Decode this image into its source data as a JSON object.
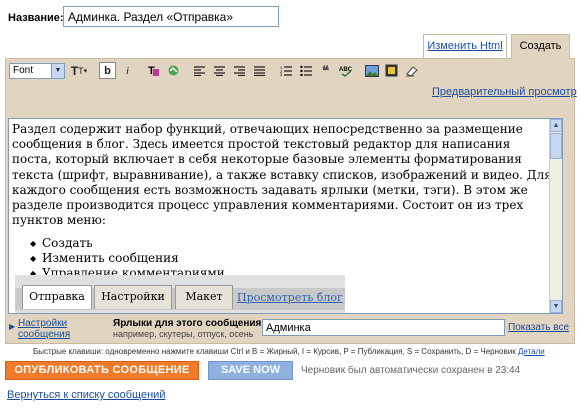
{
  "post": {
    "title_label": "Название:",
    "title_value": "Админка. Раздел «Отправка»"
  },
  "tabs": {
    "edit_html": "Изменить Html",
    "create": "Создать"
  },
  "toolbar": {
    "font_label": "Font",
    "icons": [
      "font-size-icon",
      "bold-icon",
      "italic-icon",
      "text-color-icon",
      "highlight-icon",
      "align-left-icon",
      "align-center-icon",
      "align-right-icon",
      "justify-icon",
      "numbered-list-icon",
      "bullet-list-icon",
      "blockquote-icon",
      "spellcheck-icon",
      "image-icon",
      "video-icon",
      "eraser-icon"
    ]
  },
  "preview": {
    "link": "Предварительный просмотр"
  },
  "content": {
    "paragraph": "Раздел содержит набор функций, отвечающих непосредственно за размещение сообщения в блог. Здесь имеется простой текстовый редактор для написания поста, который включает в себя некоторые базовые элементы форматирования текста (шрифт, выравнивание), а также вставку списков, изображений и видео. Для каждого сообщения есть возможность задавать ярлыки (метки, тэги). В этом же разделе производится процесс управления комментариями. Состоит он из трех пунктов меню:",
    "list": [
      "Создать",
      "Изменить сообщения",
      "Управление комментариями"
    ],
    "embed_tabs": [
      "Отправка",
      "Настройки",
      "Макет"
    ],
    "embed_link": "Просмотреть блог"
  },
  "labels": {
    "settings": "Настройки сообщения",
    "title": "Ярлыки для этого сообщения:",
    "example": "например, скутеры, отпуск, осень",
    "value": "Админка",
    "show_all": "Показать все"
  },
  "hotkeys": {
    "text": "Быстрые клавиши: одновременно нажмите клавиши Ctrl и B = Жирный, I = Курсив, P = Публикация, S = Сохранить, D = Черновик",
    "details": "Детали"
  },
  "actions": {
    "publish": "ОПУБЛИКОВАТЬ СООБЩЕНИЕ",
    "save": "SAVE NOW",
    "autosave": "Черновик был автоматически сохранен в 23:44",
    "back": "Вернуться к списку сообщений"
  },
  "colors": {
    "frame_bg": "#e1d4c0",
    "link": "#1a4fa0",
    "publish": "#f07b2a",
    "save": "#8fb1e0"
  }
}
